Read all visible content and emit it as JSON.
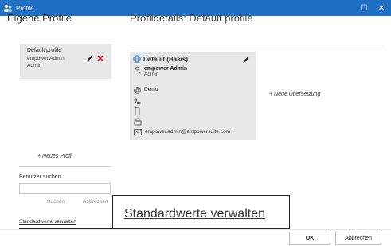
{
  "window": {
    "title": "Profile",
    "controls": {
      "maximize": "☐",
      "close": "✕"
    },
    "accent": "#1f6fc5"
  },
  "left": {
    "heading": "Eigene Profile",
    "profile": {
      "name": "Default profile",
      "line1": "empower Admin",
      "line2": "Admin"
    },
    "new_profile": "+  Neues Profil",
    "search_label": "Benutzer suchen",
    "search_value": "",
    "search_button": "Suchen",
    "cancel_button": "Abbrechen",
    "manage_defaults": "Standardwerte verwalten"
  },
  "details": {
    "heading": "Profildetails: Default profile",
    "language": "Default (Basis)",
    "user_name": "empower Admin",
    "user_role": "Admin",
    "company": "Demo",
    "email": "empower.admin@empowersuite.com",
    "new_translation": "+  Neue Übersetzung"
  },
  "callout": {
    "text": "Standardwerte verwalten"
  },
  "footer": {
    "ok": "OK",
    "cancel": "Abbrechen"
  },
  "colors": {
    "delete_icon": "#e02020",
    "card_bg": "#e8e8e8"
  }
}
